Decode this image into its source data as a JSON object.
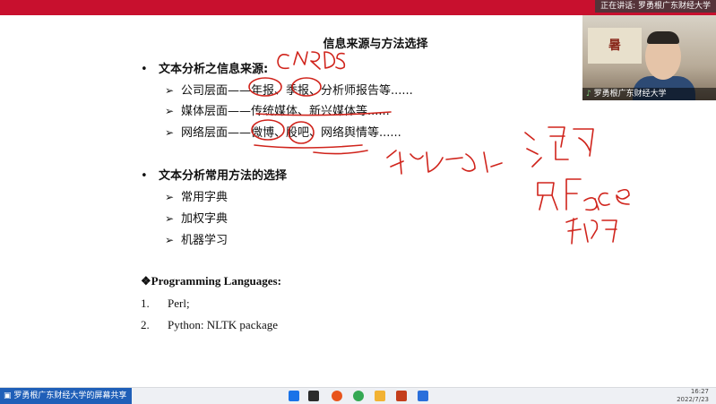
{
  "top_bar": {
    "speaking_text": "正在讲话: 罗勇根广东财经大学"
  },
  "slide": {
    "title": "信息来源与方法选择",
    "bullet1": "文本分析之信息来源:",
    "sources": [
      "公司层面——年报、季报、分析师报告等......",
      "媒体层面——传统媒体、新兴媒体等......",
      "网络层面——微博、股吧、网络舆情等......"
    ],
    "bullet2": "文本分析常用方法的选择",
    "methods": [
      "常用字典",
      "加权字典",
      "机器学习"
    ],
    "prog_heading": "❖Programming Languages:",
    "prog_items": [
      {
        "num": "1.",
        "text": "Perl;"
      },
      {
        "num": "2.",
        "text": "Python: NLTK package"
      }
    ]
  },
  "webcam": {
    "banner_text": "暑",
    "name_label": "罗勇根广东财经大学"
  },
  "taskbar": {
    "share_label": "罗勇根广东财经大学的屏幕共享",
    "time": "16:27",
    "date": "2022/7/23"
  },
  "colors": {
    "accent_red": "#c8102e",
    "ink": "#d0241c",
    "share_blue": "#1f5fb8"
  }
}
